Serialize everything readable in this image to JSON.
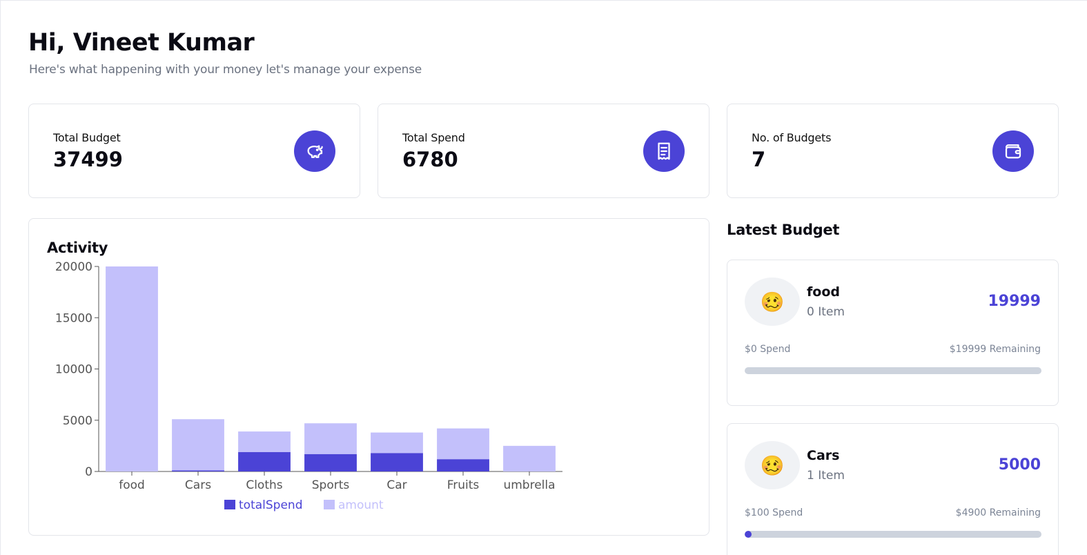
{
  "header": {
    "greeting": "Hi, Vineet Kumar",
    "subtitle": "Here's what happening with your money let's manage your expense"
  },
  "stats": [
    {
      "label": "Total Budget",
      "value": "37499",
      "icon": "piggy-bank-icon"
    },
    {
      "label": "Total Spend",
      "value": "6780",
      "icon": "receipt-icon"
    },
    {
      "label": "No. of Budgets",
      "value": "7",
      "icon": "wallet-icon"
    }
  ],
  "activity": {
    "title": "Activity"
  },
  "chart_data": {
    "type": "bar",
    "stacked": true,
    "categories": [
      "food",
      "Cars",
      "Cloths",
      "Sports",
      "Car",
      "Fruits",
      "umbrella"
    ],
    "series": [
      {
        "name": "totalSpend",
        "values": [
          0,
          100,
          1900,
          1700,
          1800,
          1200,
          0
        ],
        "color": "#4b43d6"
      },
      {
        "name": "amount",
        "values": [
          19999,
          5000,
          2000,
          3000,
          2000,
          3000,
          2500
        ],
        "color": "#c3c0fb"
      }
    ],
    "yticks": [
      "0",
      "5000",
      "10000",
      "15000",
      "20000"
    ],
    "ylim": [
      0,
      20000
    ],
    "legend": "bottom"
  },
  "latest": {
    "title": "Latest Budget",
    "budgets": [
      {
        "emoji": "🥴",
        "name": "food",
        "items": "0 Item",
        "amount": "19999",
        "spend": "$0 Spend",
        "remaining": "$19999 Remaining",
        "progress": 0
      },
      {
        "emoji": "🥴",
        "name": "Cars",
        "items": "1 Item",
        "amount": "5000",
        "spend": "$100 Spend",
        "remaining": "$4900 Remaining",
        "progress": 0.02
      }
    ]
  }
}
